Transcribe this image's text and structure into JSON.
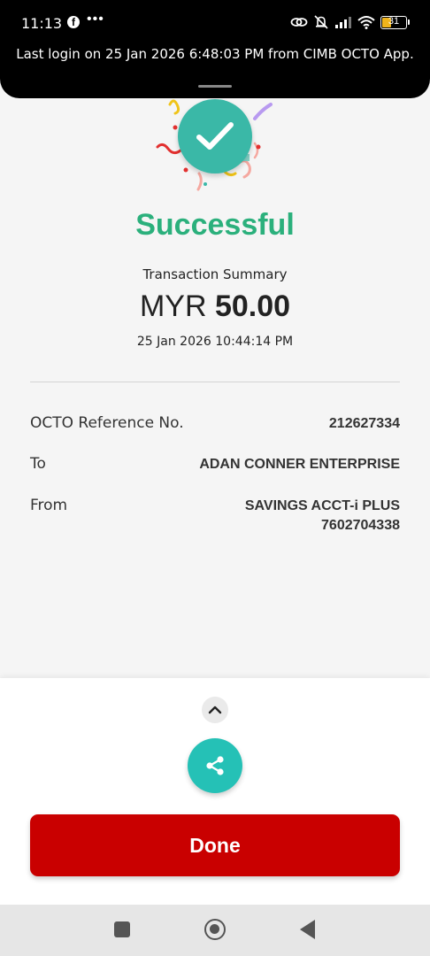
{
  "status_bar": {
    "time": "11:13",
    "notification_icons": [
      "facebook-icon",
      "more-dots-icon"
    ],
    "system_icons": [
      "link-icon",
      "mute-icon",
      "signal-icon",
      "wifi-icon",
      "battery-icon"
    ],
    "battery": "31"
  },
  "banner": {
    "text": "Last login on 25 Jan 2026 6:48:03 PM from CIMB OCTO App."
  },
  "result": {
    "title": "Successful",
    "summary_label": "Transaction Summary",
    "currency": "MYR",
    "amount": "50.00",
    "datetime": "25 Jan 2026 10:44:14 PM"
  },
  "details": {
    "reference_label": "OCTO Reference No.",
    "reference_value": "212627334",
    "to_label": "To",
    "to_value": "ADAN CONNER ENTERPRISE",
    "from_label": "From",
    "from_account_name": "SAVINGS ACCT-i PLUS",
    "from_account_number": "7602704338"
  },
  "actions": {
    "done_label": "Done"
  },
  "colors": {
    "success_green": "#2bb07c",
    "badge_teal": "#3ab8a7",
    "share_teal": "#25c1b6",
    "done_red": "#c90000"
  }
}
